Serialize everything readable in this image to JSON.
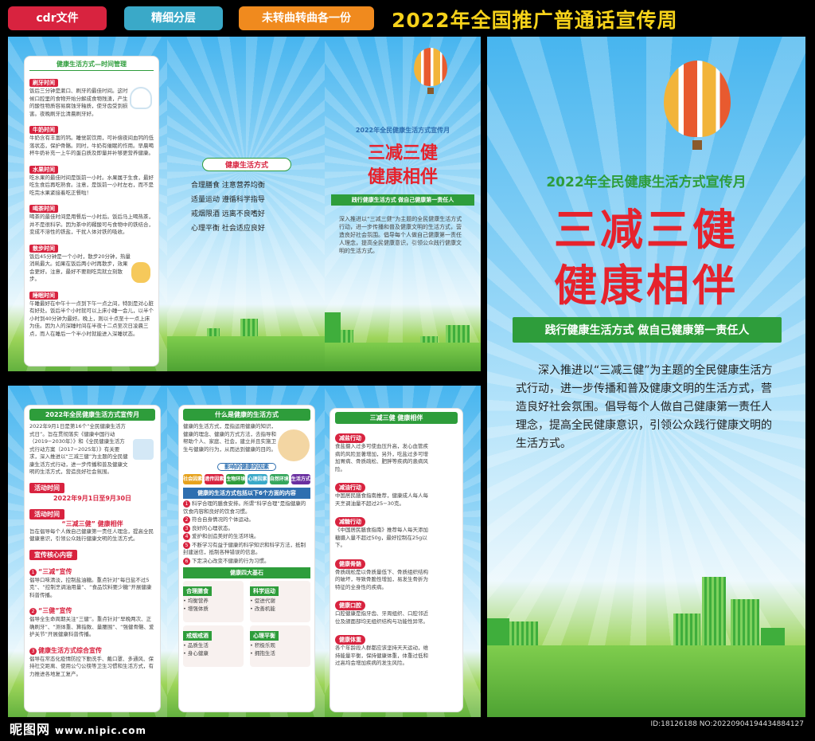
{
  "topbar": {
    "tags": [
      "cdr文件",
      "精细分层",
      "未转曲转曲各一份"
    ],
    "headline": "2022年全国推广普通话宣传周"
  },
  "time_mgmt": {
    "title": "健康生活方式—时间管理",
    "items": [
      {
        "label": "刷牙时间",
        "text": "饭后三分钟是漱口、刷牙的最佳时间。这时候口腔里的食物开始分解成食物残渣，产生的酸性物质容易腐蚀牙釉质，使牙齿受到损害。夜晚刷牙比清晨刷牙好。"
      },
      {
        "label": "牛奶时间",
        "text": "牛奶含有丰富的钙。睡觉前饮用，可补偿夜间血钙的低落状态，保护骨骼。同时，牛奶有催眠的作用。早晨喝杯牛奶补充一上午的蛋白质及即量并补够更营养健康。"
      },
      {
        "label": "水果时间",
        "text": "吃水果的最佳时间是饭前一小时。水果属于生食，最好吃生食后再吃熟食。注意，是饭前一小时左右，而不是吃完水果紧接着吃正餐啦！"
      },
      {
        "label": "喝茶时间",
        "text": "喝茶的最佳时间是用餐后一小时后。饭后马上喝热茶，并不是很科学。因为茶中的鞣酸可与食物中的铁结合，变成不溶性的铁盐，干扰人体对铁的吸收。"
      },
      {
        "label": "散步时间",
        "text": "饭后45分钟是一个小时，散步20分钟，热量消耗最大。如果在饭后两小时再散步，效果会更好。注意，最好不要刚吃完就立刻散步。"
      },
      {
        "label": "睡眠时间",
        "text": "午睡最好在中午十一点到下午一点之间，特别是对心脏有好处。饭后半个小时就可以上床小睡一会儿，以半个小时到40分钟为最好。晚上，则以十点至十一点上床为佳。因为人的深睡时间在半夜十二点至次日凌晨三点，而人在睡后一个半小时就能进入深睡状态。"
      }
    ]
  },
  "lifestyle": {
    "title": "健康生活方式",
    "lines": [
      "合理膳食  注意营养均衡",
      "适量运动  遵循科学指导",
      "戒烟限酒  远离不良嗜好",
      "心理平衡  社会适应良好"
    ]
  },
  "cover": {
    "month": "2022年全民健康生活方式宣传月",
    "title1": "三减三健",
    "title2": "健康相伴",
    "slogan": "践行健康生活方式  做自己健康第一责任人",
    "body": "深入推进以“三减三健”为主题的全民健康生活方式行动，进一步传播和普及健康文明的生活方式，营造良好社会氛围。倡导每个人做自己健康第一责任人理念，提高全民健康意识，引领公众践行健康文明的生活方式。"
  },
  "intro": {
    "title": "2022年全民健康生活方式宣传月",
    "body": "2022年9月1日是第16个“全民健康生活方式日”。旨在贯彻落实《健康中国行动（2019−2030年）》和《全民健康生活方式行动方案（2017−2025年）》有关要求，深入推进以“三减三健”为主题的全民健康生活方式行动，进一步传播和普及健康文明的生活方式，营造良好社会氛围。",
    "period_label": "活动时间",
    "period": "2022年9月1日至9月30日",
    "theme_label": "活动时间",
    "theme": "“三减三健”  健康相伴",
    "theme_body": "旨在倡导每个人做自己健康第一责任人理念，提高全民健康意识，引领公众践行健康文明的生活方式。",
    "core_label": "宣传核心内容",
    "points": [
      {
        "n": "1",
        "title": "“三减”宣传",
        "text": "倡导口味清淡，控制盐油糖。重点针对“每日盐不过5克”、“控制烹调油用量”、“食品饮料要少糖”开展健康科普传播。"
      },
      {
        "n": "2",
        "title": "“三健”宣传",
        "text": "倡导全生命周期关注“三健”。重点针对“早晚两次、正确刷牙”、“测体重、算指数、量腰围”、“强健骨骼、爱护关节”开展健康科普传播。"
      },
      {
        "n": "3",
        "title": "健康生活方式综合宣传",
        "text": "倡导在常态化疫情防控下勤洗手、戴口罩、多通风、保持社交距离、使用公勺公筷等卫生习惯和生活方式，有力推进各地复工复产。"
      }
    ]
  },
  "what": {
    "title": "什么是健康的生活方式",
    "body": "健康的生活方式，是指运用健康的知识，健康的理念、健康的方式方法，去指导和帮助个人、家庭、社会，建立并且实施卫生与健康的行为，从而达到健康的目的。",
    "factors_title": "影响的健康的因素",
    "factors": [
      {
        "label": "社会因素",
        "color": "#e6a21d"
      },
      {
        "label": "遗传因素",
        "color": "#d8233f"
      },
      {
        "label": "生物环境",
        "color": "#2e9d3b"
      },
      {
        "label": "心理因素",
        "color": "#3aa9c8"
      },
      {
        "label": "自然环境",
        "color": "#35a65c"
      },
      {
        "label": "生活方式",
        "color": "#6a2fa0"
      }
    ],
    "six_title": "健康的生活方式包括以下6个方面的内容",
    "six": [
      "科学合理的膳食安排。所谓“科学合理”是指健康的饮食内容和良好的饮食习惯。",
      "符合自身情况的个体运动。",
      "良好的心理状态。",
      "爱护和创造美好的生活环境。",
      "不断学习有益于健康的科学知识和科学方法，抵制封建迷信，抵制各种错误的信息。",
      "下定决心改变不健康的行为习惯。"
    ],
    "stones_title": "健康四大基石",
    "stones": [
      {
        "label": "合理膳食",
        "items": [
          "均衡营养",
          "增强体质"
        ]
      },
      {
        "label": "科学运动",
        "items": [
          "促进代谢",
          "改善机能"
        ]
      },
      {
        "label": "戒烟戒酒",
        "items": [
          "品质生活",
          "身心健康"
        ]
      },
      {
        "label": "心理平衡",
        "items": [
          "积极乐观",
          "拥抱生活"
        ]
      }
    ]
  },
  "sanjian": {
    "title": "三减三健    健康相伴",
    "items": [
      {
        "label": "减盐行动",
        "text": "食盐摄入过多可使血压升高，发心血管疾病的风险显著增加，另外，吃盐过多可增加胃病、骨质疏松、肥胖等疾病的患病风险。"
      },
      {
        "label": "减油行动",
        "text": "中国居民膳食指南推荐，健康成人每人每天烹调油量不超过25−30克。"
      },
      {
        "label": "减糖行动",
        "text": "《中国居民膳食指南》推荐每人每天添加糖摄入量不超过50g，最好控制在25g以下。"
      },
      {
        "label": "健康骨骼",
        "text": "骨质疏松是以骨质量低下、骨质组织结构的破坏，导致骨脆性增加，易发生骨折为特征的全身性的疾病。"
      },
      {
        "label": "健康口腔",
        "text": "口腔健康是指牙齿、牙周组织、口腔邻近位及颌面部均无组织结构与功能性异常。"
      },
      {
        "label": "健康体重",
        "text": "各个年龄段人群都应该坚持天天运动，维持能量平衡，保持健康体重，体重过低和过高均会增加疾病的发生风险。"
      }
    ]
  },
  "footer": {
    "logo": "昵图网",
    "url": "www.nipic.com",
    "id": "ID:18126188 NO:20220904194434884127"
  }
}
